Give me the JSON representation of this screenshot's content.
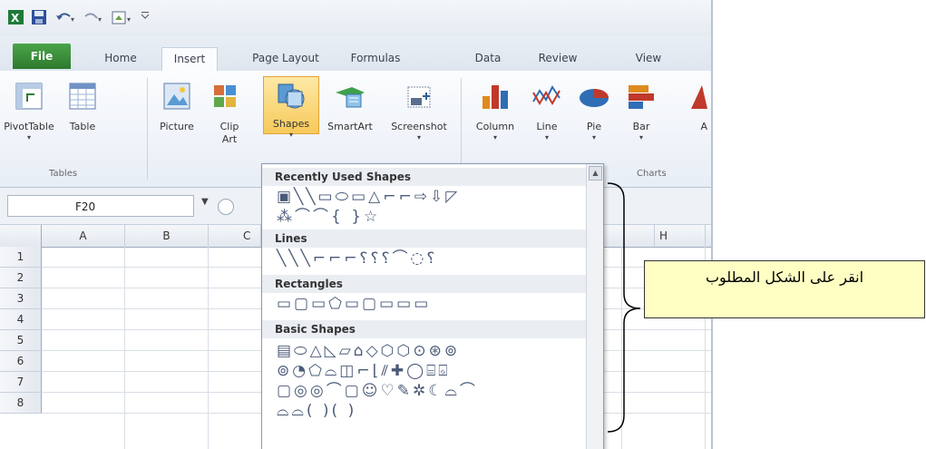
{
  "tabs": [
    "File",
    "Home",
    "Insert",
    "Page Layout",
    "Formulas",
    "Data",
    "Review",
    "View"
  ],
  "ribbon": {
    "pivot": {
      "label": "PivotTable"
    },
    "table": {
      "label": "Table"
    },
    "picture": {
      "label": "Picture"
    },
    "clipart": {
      "label": "Clip Art"
    },
    "shapes": {
      "label": "Shapes"
    },
    "smartart": {
      "label": "SmartArt"
    },
    "screenshot": {
      "label": "Screenshot"
    },
    "column": {
      "label": "Column"
    },
    "line": {
      "label": "Line"
    },
    "pie": {
      "label": "Pie"
    },
    "bar": {
      "label": "Bar"
    },
    "area_partial": {
      "label": "A"
    },
    "groups": {
      "tables": "Tables",
      "charts": "Charts"
    }
  },
  "formula_bar": {
    "name_box": "F20"
  },
  "grid": {
    "columns": [
      "A",
      "B",
      "C",
      "H"
    ],
    "rows": [
      "1",
      "2",
      "3",
      "4",
      "5",
      "6",
      "7",
      "8"
    ]
  },
  "dropdown": {
    "sections": {
      "recent": "Recently Used Shapes",
      "lines": "Lines",
      "rectangles": "Rectangles",
      "basic": "Basic Shapes"
    },
    "shape_rows": {
      "recent1": "▣╲╲▭⬭▭△⌐⌐⇨⇩◸",
      "recent2": "⁂⌒⌒{ }☆",
      "lines1": "╲╲╲⌐⌐⌐⸮⸮⸮⌒◌⸮",
      "rect1": "▭▢▭⬠▭▢▭▭▭",
      "basic1": "▤⬭△◺▱⌂◇⬡⬡⊙⊛⊚",
      "basic2": "⊚◔⬠⌓◫⌐⌊⫽✚◯⌸⌺",
      "basic3": "▢◎◎⌒▢☺♡✎✲☾⌓⌒",
      "basic4": "⌓⌓( )( )"
    }
  },
  "callout": {
    "text": "انقر على الشكل المطلوب"
  },
  "colors": {
    "file_tab": "#2d7a2d",
    "callout_bg": "#ffffc4",
    "shapes_highlight": "#f7c95a"
  }
}
